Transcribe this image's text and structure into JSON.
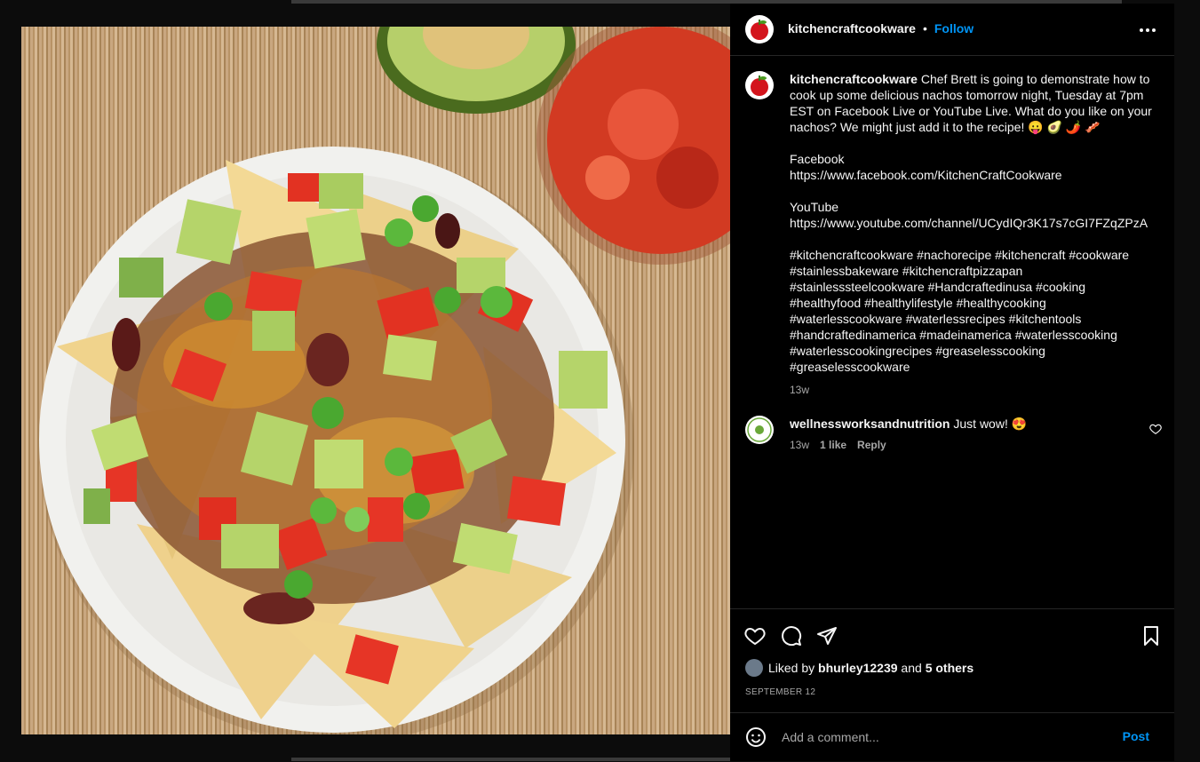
{
  "post": {
    "username": "kitchencraftcookware",
    "follow_label": "Follow",
    "separator": "•",
    "caption_text": " Chef Brett is going to demonstrate how to cook up some delicious nachos tomorrow night, Tuesday at 7pm EST on Facebook Live or YouTube Live. What do you like on your nachos? We might just add it to the recipe! 😛 🥑 🌶️ 🥓",
    "links_block": "Facebook\nhttps://www.facebook.com/KitchenCraftCookware\n\nYouTube\nhttps://www.youtube.com/channel/UCydIQr3K17s7cGI7FZqZPzA",
    "hashtags": "#kitchencraftcookware #nachorecipe #kitchencraft #cookware #stainlessbakeware #kitchencraftpizzapan #stainlesssteelcookware #Handcraftedinusa #cooking #healthyfood #healthylifestyle #healthycooking #waterlesscookware #waterlessrecipes #kitchentools #handcraftedinamerica #madeinamerica #waterlesscooking #waterlesscookingrecipes #greaselesscooking #greaselesscookware",
    "caption_age": "13w"
  },
  "comment": {
    "username": "wellnessworksandnutrition",
    "text": " Just wow! 😍",
    "age": "13w",
    "likes": "1 like",
    "reply_label": "Reply"
  },
  "likes": {
    "prefix": "Liked by ",
    "user": "bhurley12239",
    "middle": " and ",
    "others": "5 others"
  },
  "date": "SEPTEMBER 12",
  "add_comment": {
    "placeholder": "Add a comment...",
    "post_label": "Post"
  },
  "icons": {
    "more": "more-options-icon",
    "like": "heart-icon",
    "comment": "comment-icon",
    "share": "send-icon",
    "save": "bookmark-icon",
    "emoji": "emoji-icon"
  },
  "colors": {
    "accent": "#0095f6",
    "background": "#000000",
    "muted": "#a8a8a8"
  }
}
